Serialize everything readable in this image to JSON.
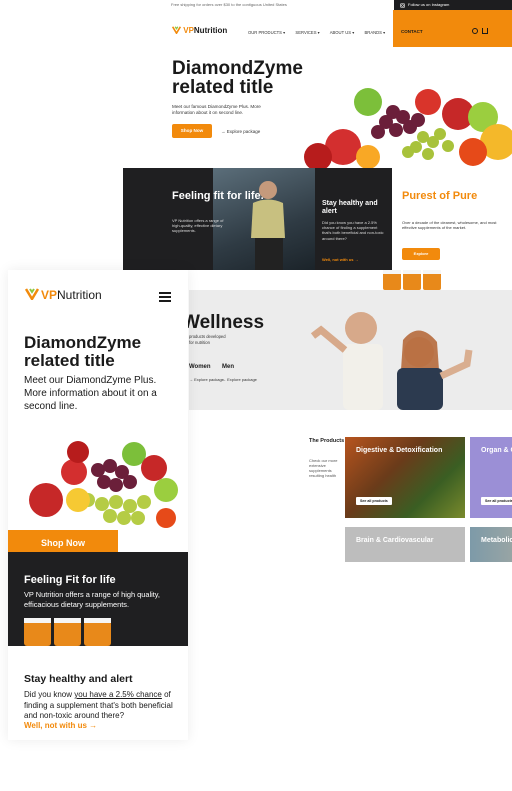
{
  "desktop": {
    "topbar": {
      "shipping": "Free shipping for orders over $30 to the contiguous United States",
      "instagram": "Follow us on Instagram"
    },
    "logo": {
      "prefix": "VP",
      "name": "Nutrition"
    },
    "nav": [
      "OUR PRODUCTS ▾",
      "SERVICES ▾",
      "ABOUT US ▾",
      "BRANDS ▾"
    ],
    "contact": "CONTACT",
    "hero": {
      "title": "DiamondZyme related title",
      "subtitle": "Meet our famous DiamondZyme Plus. More information about it on second line.",
      "shop_label": "Shop Now",
      "explore_label": "→  Explore package"
    },
    "feeling": {
      "title": "Feeling fit for life.",
      "text": "VP Nutrition offers a range of high-quality, effective dietary supplements."
    },
    "stay": {
      "title": "Stay healthy and alert",
      "text": "Did you know you have a 2.5% chance of finding a supplement that's both beneficial and non-toxic around there?",
      "link": "Well, not with us  →"
    },
    "pure": {
      "title": "Purest of Pure",
      "text": "Over a decade of the cleanest, wholesome, and most effective supplements of the market.",
      "button": "Explore"
    },
    "wellness": {
      "title": "Wellness",
      "text": "products developed for nutrition",
      "women": "Women",
      "men": "Men",
      "explore_women": "→  Explore package",
      "explore_men": "→  Explore package"
    },
    "categories": {
      "heading": "The Products",
      "text": "Check our more extensive supplements resulting health",
      "tiles": [
        {
          "title": "Digestive & Detoxification",
          "cta": "See all products"
        },
        {
          "title": "Organ & Glandular",
          "cta": "See all products"
        },
        {
          "title": "Brain & Cardiovascular"
        },
        {
          "title": "Metabolic Maintenance"
        }
      ]
    }
  },
  "mobile": {
    "logo": {
      "prefix": "VP",
      "name": "Nutrition"
    },
    "hero": {
      "title": "DiamondZyme related title",
      "subtitle": "Meet our DiamondZyme Plus. More information about it on a second line.",
      "shop_label": "Shop Now"
    },
    "feeling": {
      "title": "Feeling Fit for life",
      "text": "VP Nutrition offers a range of high quality, efficacious dietary supplements."
    },
    "stay": {
      "title": "Stay healthy and alert",
      "text_before": "Did you know ",
      "text_underlined": "you have a 2.5% chance",
      "text_after": " of finding a supplement that's both beneficial and non-toxic around there?",
      "link": "Well, not with us  →"
    }
  },
  "colors": {
    "accent": "#f28a0c",
    "dark": "#1f1f21",
    "lavender": "#9b8fd6"
  },
  "icons": [
    "instagram-icon",
    "user-icon",
    "cart-icon",
    "menu-icon",
    "logo-mark-icon"
  ]
}
